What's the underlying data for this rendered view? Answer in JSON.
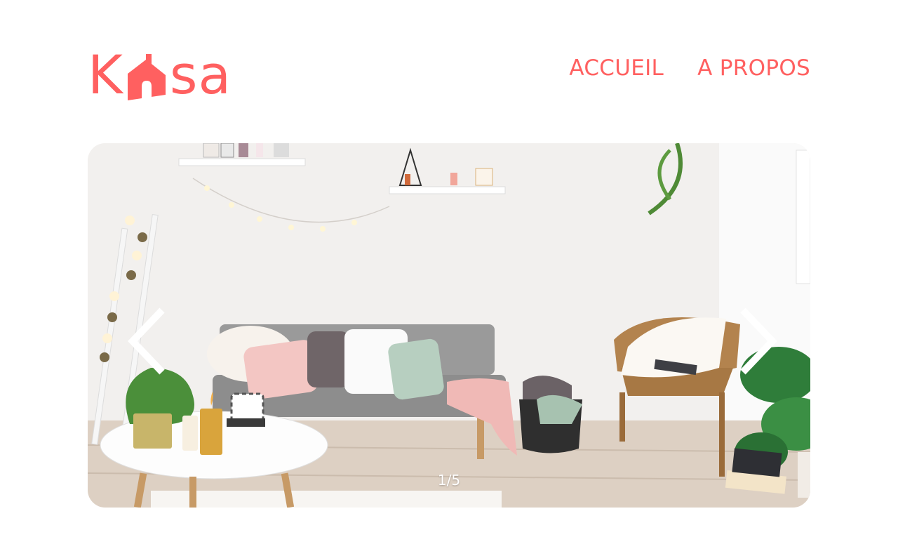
{
  "brand": {
    "logo_left": "K",
    "logo_right": "sa",
    "color": "#FF6060"
  },
  "nav": {
    "items": [
      {
        "label": "ACCUEIL"
      },
      {
        "label": "A PROPOS"
      }
    ]
  },
  "gallery": {
    "counter": "1/5",
    "current": 1,
    "total": 5,
    "prev_icon": "chevron-left-icon",
    "next_icon": "chevron-right-icon"
  }
}
